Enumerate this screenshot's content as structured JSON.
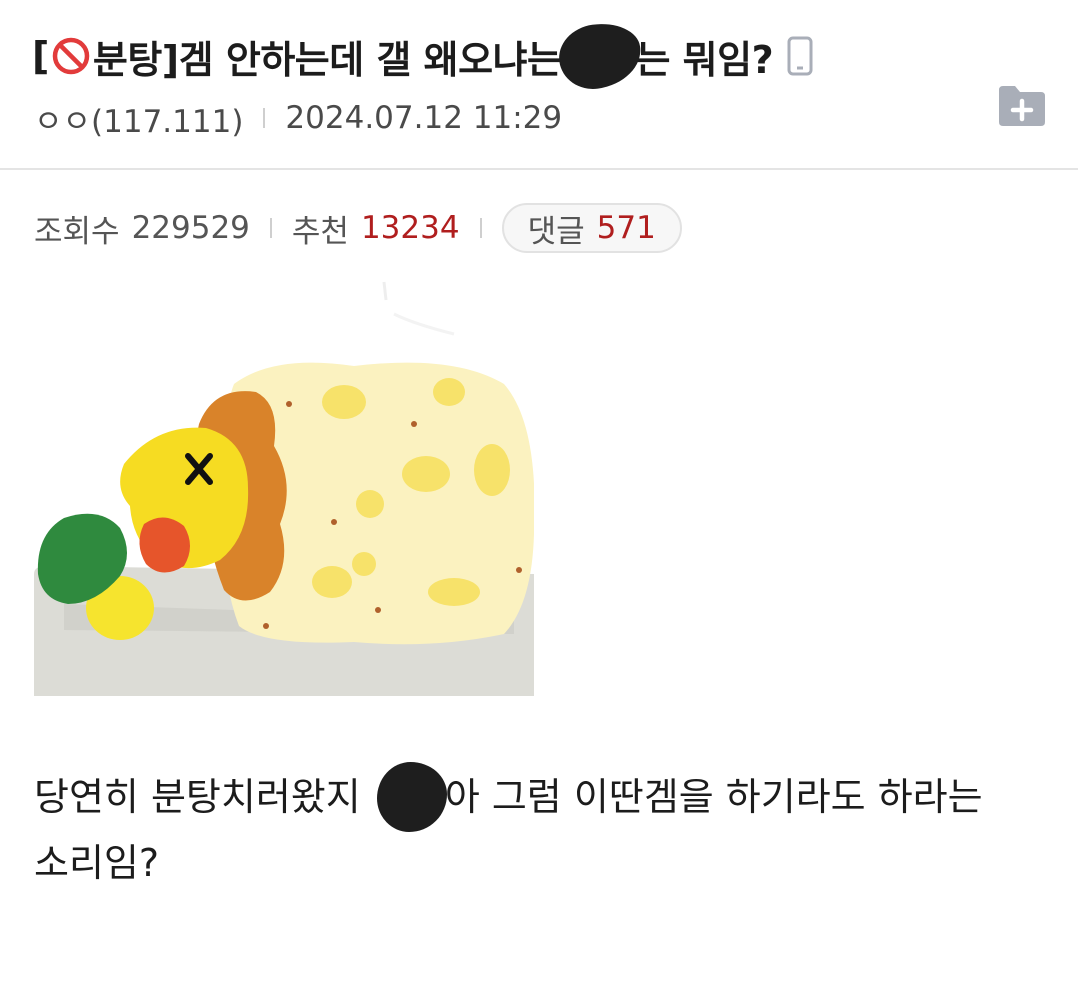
{
  "post": {
    "title_prefix": "[",
    "title_tag": "분탕]",
    "title_main": " 겜 안하는데 갤 왜오냐는",
    "title_after": "는 뭐임?",
    "author": "ㅇㅇ(117.111)",
    "date": "2024.07.12 11:29",
    "icons": {
      "tag_icon": "prohibited-icon",
      "device_icon": "mobile-phone-icon",
      "scrap_icon": "folder-plus-icon"
    }
  },
  "stats": {
    "views_label": "조회수",
    "views_value": "229529",
    "recommend_label": "추천",
    "recommend_value": "13234",
    "comments_label": "댓글",
    "comments_value": "571"
  },
  "content": {
    "line1_before": "당연히 분탕치러왔지 ",
    "line1_after": "아 그럼 이딴겜을 하기라도 하라는",
    "line2": "소리임?"
  },
  "colors": {
    "accent_red": "#b01e1e",
    "prohibit_red": "#e23b3b",
    "icon_gray": "#a9aeb8"
  }
}
